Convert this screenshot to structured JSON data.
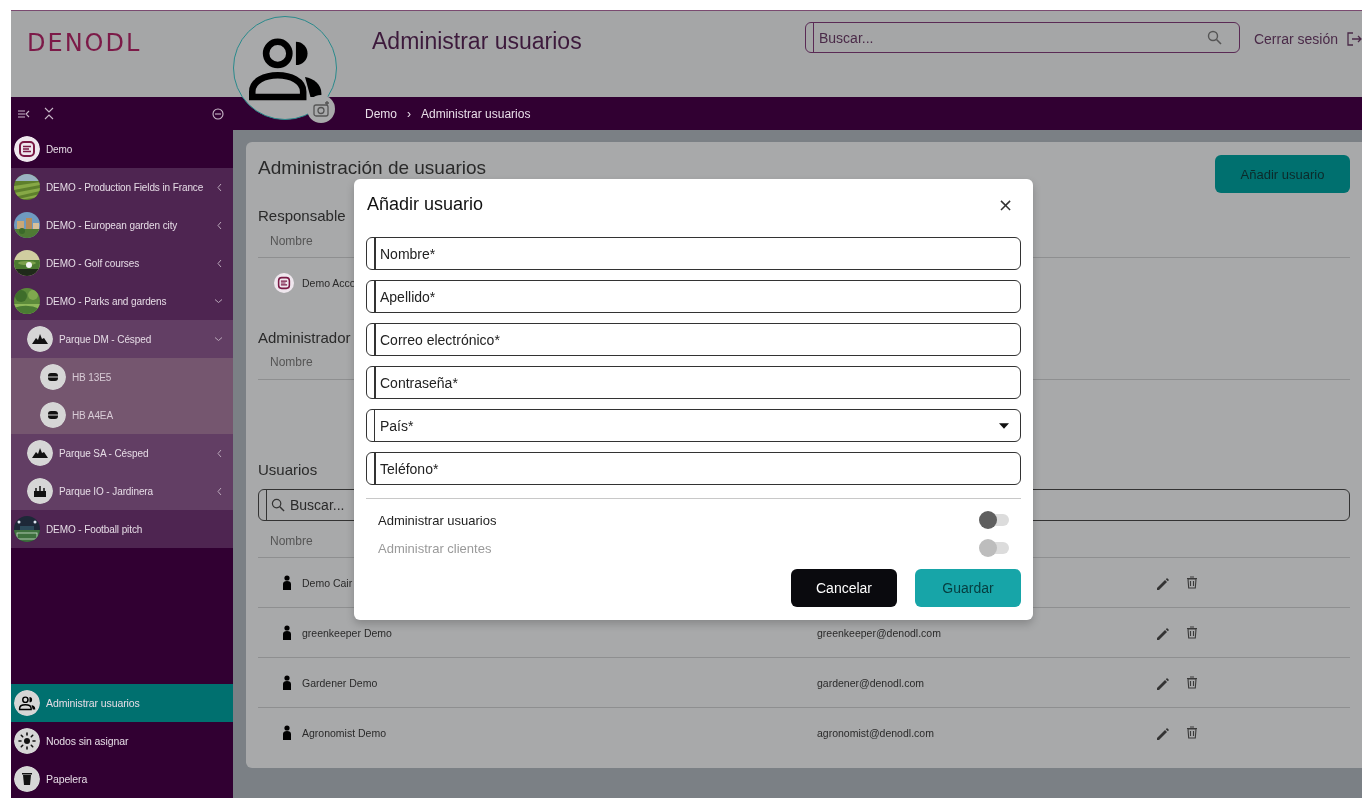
{
  "header": {
    "logo": "DENODL",
    "title": "Administrar usuarios",
    "search": {
      "placeholder": "Buscar..."
    },
    "logout": "Cerrar sesión"
  },
  "breadcrumb": {
    "items": [
      "Demo",
      "Administrar usuarios"
    ],
    "separator": "›"
  },
  "sidebar": {
    "items": [
      {
        "label": "Demo",
        "kind": "account",
        "children": [
          {
            "label": "DEMO - Production Fields in France",
            "kind": "site",
            "expanded": false
          },
          {
            "label": "DEMO - European garden city",
            "kind": "site",
            "expanded": false
          },
          {
            "label": "DEMO - Golf courses",
            "kind": "site",
            "expanded": false
          },
          {
            "label": "DEMO - Parks and gardens",
            "kind": "site",
            "expanded": true,
            "children": [
              {
                "label": "Parque DM - Césped",
                "kind": "park",
                "expanded": true,
                "children": [
                  {
                    "label": "HB 13E5",
                    "kind": "node"
                  },
                  {
                    "label": "HB A4EA",
                    "kind": "node"
                  }
                ]
              },
              {
                "label": "Parque SA - Césped",
                "kind": "park",
                "expanded": false
              },
              {
                "label": "Parque IO - Jardinera",
                "kind": "planter",
                "expanded": false
              }
            ]
          },
          {
            "label": "DEMO - Football pitch",
            "kind": "site"
          }
        ]
      }
    ],
    "footer": [
      {
        "label": "Administrar usuarios",
        "kind": "users",
        "selected": true
      },
      {
        "label": "Nodos sin asignar",
        "kind": "nodes",
        "selected": false
      },
      {
        "label": "Papelera",
        "kind": "trash",
        "selected": false
      }
    ]
  },
  "main": {
    "title": "Administración de usuarios",
    "add_button": "Añadir usuario",
    "responsible": {
      "heading": "Responsable",
      "columns": [
        "Nombre"
      ],
      "rows": [
        {
          "name": "Demo Acco",
          "kind": "account"
        }
      ]
    },
    "administrators": {
      "heading": "Administrador",
      "columns": [
        "Nombre"
      ]
    },
    "users": {
      "heading": "Usuarios",
      "search": {
        "placeholder": "Buscar..."
      },
      "columns": [
        "Nombre"
      ],
      "rows": [
        {
          "name": "Demo Cair",
          "kind": "person"
        },
        {
          "name": "greenkeeper Demo",
          "email": "greenkeeper@denodl.com",
          "kind": "person"
        },
        {
          "name": "Gardener Demo",
          "email": "gardener@denodl.com",
          "kind": "person"
        },
        {
          "name": "Agronomist Demo",
          "email": "agronomist@denodl.com",
          "kind": "person"
        }
      ]
    }
  },
  "dialog": {
    "title": "Añadir usuario",
    "close": "×",
    "fields": [
      {
        "placeholder": "Nombre*",
        "kind": "text"
      },
      {
        "placeholder": "Apellido*",
        "kind": "text"
      },
      {
        "placeholder": "Correo electrónico*",
        "kind": "text"
      },
      {
        "placeholder": "Contraseña*",
        "kind": "text"
      },
      {
        "placeholder": "País*",
        "kind": "select"
      },
      {
        "placeholder": "Teléfono*",
        "kind": "text"
      }
    ],
    "toggles": [
      {
        "label": "Administrar usuarios",
        "on": false,
        "disabled": false
      },
      {
        "label": "Administrar clientes",
        "on": false,
        "disabled": true
      }
    ],
    "buttons": [
      {
        "label": "Cancelar",
        "kind": "secondary"
      },
      {
        "label": "Guardar",
        "kind": "primary"
      }
    ]
  }
}
